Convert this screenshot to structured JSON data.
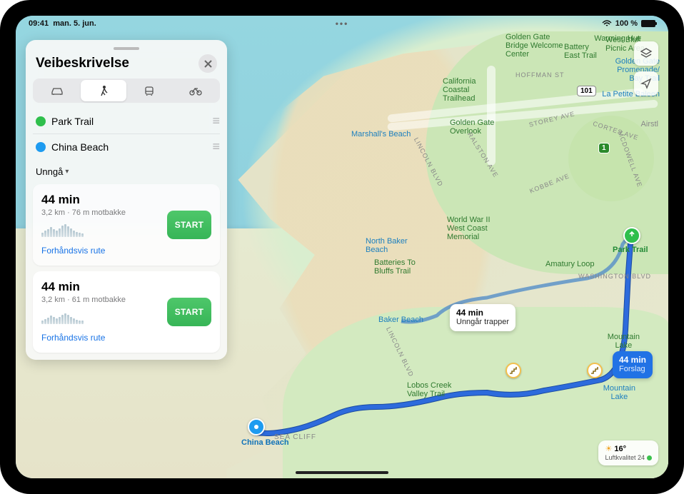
{
  "status": {
    "time": "09:41",
    "date": "man. 5. jun.",
    "battery": "100 %"
  },
  "panel": {
    "title": "Veibeskrivelse",
    "stops": [
      {
        "name": "Park Trail"
      },
      {
        "name": "China Beach"
      }
    ],
    "avoid": "Unngå",
    "routes": [
      {
        "time": "44 min",
        "meta": "3,2 km · 76 m motbakke",
        "preview": "Forhåndsvis rute",
        "start": "START",
        "elev": [
          6,
          9,
          11,
          14,
          11,
          9,
          12,
          16,
          18,
          15,
          12,
          9,
          7,
          6,
          5
        ]
      },
      {
        "time": "44 min",
        "meta": "3,2 km · 61 m motbakke",
        "preview": "Forhåndsvis rute",
        "start": "START",
        "elev": [
          5,
          7,
          9,
          12,
          10,
          8,
          10,
          13,
          15,
          13,
          10,
          8,
          6,
          5,
          5
        ]
      }
    ]
  },
  "map": {
    "callout_alt": {
      "t": "44 min",
      "s": "Unngår trapper"
    },
    "callout_main": {
      "t": "44 min",
      "s": "Forslag"
    },
    "weather": {
      "temp": "16°",
      "aq": "Luftkvalitet 24"
    },
    "pin_start": "Park Trail",
    "pin_dest": "China Beach",
    "labels": {
      "marshalls": "Marshall's Beach",
      "nbaker": "North Baker\nBeach",
      "baker": "Baker Beach",
      "lobos": "Lobos Creek\nValley Trail",
      "seacliff": "SEA CLIFF",
      "batteries": "Batteries To\nBluffs Trail",
      "ww2": "World War II\nWest Coast\nMemorial",
      "coastal": "California\nCoastal\nTrailhead",
      "amatury": "Amatury Loop",
      "ggwelcome": "Golden Gate\nBridge Welcome\nCenter",
      "beast": "Battery\nEast Trail",
      "wbluff": "West Bluff\nPicnic Area",
      "warming": "Warming Hut",
      "ggprom": "Golden Gate\nPromenade/\nBay Trail",
      "petite": "La Petite Baleen",
      "overlook": "Golden Gate\nOverlook",
      "mtnlake": "Mountain\nLake",
      "mtnlake2": "Mountain\nLake",
      "lincoln": "LINCOLN BLVD",
      "lincoln2": "LINCOLN BLVD",
      "ralston": "RALSTON AVE",
      "kobbe": "KOBBE AVE",
      "storey": "STOREY AVE",
      "cortes": "CORTES AVE",
      "hoffman": "HOFFMAN ST",
      "mcdowell": "MCDOWELL AVE",
      "washington": "WASHINGTON BLVD",
      "airstl": "Airstl"
    },
    "shields": {
      "us101": "101",
      "ca1": "1"
    }
  }
}
